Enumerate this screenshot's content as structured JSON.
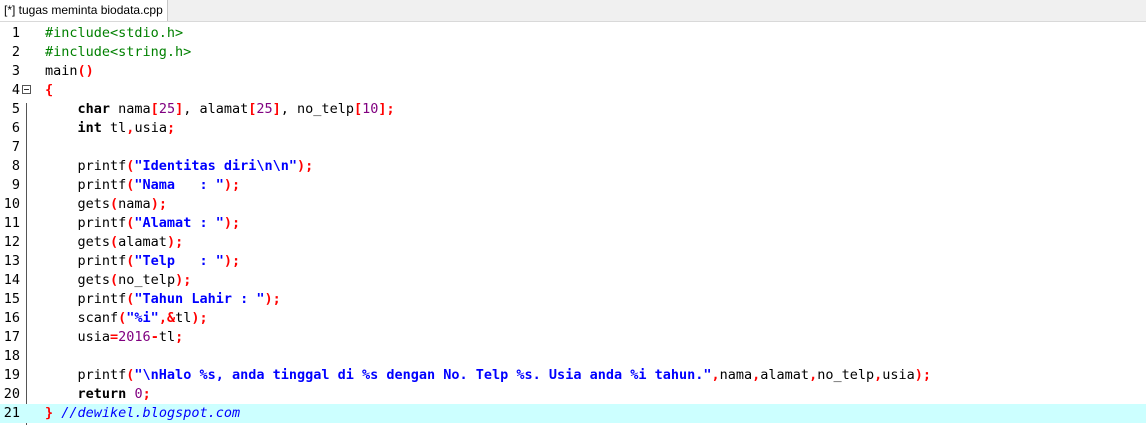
{
  "tab": {
    "label": "[*] tugas meminta biodata.cpp"
  },
  "editor": {
    "active_line": 21,
    "colors": {
      "preprocessor": "#008000",
      "symbol": "#ff0000",
      "number": "#800080",
      "string": "#0000ff",
      "comment": "#0000ff",
      "active_line_bg": "#ccffff"
    },
    "lines": [
      {
        "n": "1",
        "tokens": [
          [
            "pp",
            "#include<stdio.h>"
          ]
        ]
      },
      {
        "n": "2",
        "tokens": [
          [
            "pp",
            "#include<string.h>"
          ]
        ]
      },
      {
        "n": "3",
        "tokens": [
          [
            "id",
            "main"
          ],
          [
            "sym",
            "()"
          ]
        ]
      },
      {
        "n": "4",
        "tokens": [
          [
            "sym",
            "{"
          ]
        ]
      },
      {
        "n": "5",
        "tokens": [
          [
            "id",
            "    "
          ],
          [
            "kw",
            "char"
          ],
          [
            "id",
            " nama"
          ],
          [
            "sym",
            "["
          ],
          [
            "num",
            "25"
          ],
          [
            "sym",
            "]"
          ],
          [
            "id",
            ", alamat"
          ],
          [
            "sym",
            "["
          ],
          [
            "num",
            "25"
          ],
          [
            "sym",
            "]"
          ],
          [
            "id",
            ", no_telp"
          ],
          [
            "sym",
            "["
          ],
          [
            "num",
            "10"
          ],
          [
            "sym",
            "];"
          ]
        ]
      },
      {
        "n": "6",
        "tokens": [
          [
            "id",
            "    "
          ],
          [
            "kw",
            "int"
          ],
          [
            "id",
            " tl"
          ],
          [
            "sym",
            ","
          ],
          [
            "id",
            "usia"
          ],
          [
            "sym",
            ";"
          ]
        ]
      },
      {
        "n": "7",
        "tokens": []
      },
      {
        "n": "8",
        "tokens": [
          [
            "id",
            "    printf"
          ],
          [
            "sym",
            "("
          ],
          [
            "str",
            "\"Identitas diri\\n\\n\""
          ],
          [
            "sym",
            ");"
          ]
        ]
      },
      {
        "n": "9",
        "tokens": [
          [
            "id",
            "    printf"
          ],
          [
            "sym",
            "("
          ],
          [
            "str",
            "\"Nama   : \""
          ],
          [
            "sym",
            ");"
          ]
        ]
      },
      {
        "n": "10",
        "tokens": [
          [
            "id",
            "    gets"
          ],
          [
            "sym",
            "("
          ],
          [
            "id",
            "nama"
          ],
          [
            "sym",
            ");"
          ]
        ]
      },
      {
        "n": "11",
        "tokens": [
          [
            "id",
            "    printf"
          ],
          [
            "sym",
            "("
          ],
          [
            "str",
            "\"Alamat : \""
          ],
          [
            "sym",
            ");"
          ]
        ]
      },
      {
        "n": "12",
        "tokens": [
          [
            "id",
            "    gets"
          ],
          [
            "sym",
            "("
          ],
          [
            "id",
            "alamat"
          ],
          [
            "sym",
            ");"
          ]
        ]
      },
      {
        "n": "13",
        "tokens": [
          [
            "id",
            "    printf"
          ],
          [
            "sym",
            "("
          ],
          [
            "str",
            "\"Telp   : \""
          ],
          [
            "sym",
            ");"
          ]
        ]
      },
      {
        "n": "14",
        "tokens": [
          [
            "id",
            "    gets"
          ],
          [
            "sym",
            "("
          ],
          [
            "id",
            "no_telp"
          ],
          [
            "sym",
            ");"
          ]
        ]
      },
      {
        "n": "15",
        "tokens": [
          [
            "id",
            "    printf"
          ],
          [
            "sym",
            "("
          ],
          [
            "str",
            "\"Tahun Lahir : \""
          ],
          [
            "sym",
            ");"
          ]
        ]
      },
      {
        "n": "16",
        "tokens": [
          [
            "id",
            "    scanf"
          ],
          [
            "sym",
            "("
          ],
          [
            "str",
            "\"%i\""
          ],
          [
            "sym",
            ",&"
          ],
          [
            "id",
            "tl"
          ],
          [
            "sym",
            ");"
          ]
        ]
      },
      {
        "n": "17",
        "tokens": [
          [
            "id",
            "    usia"
          ],
          [
            "sym",
            "="
          ],
          [
            "num",
            "2016"
          ],
          [
            "sym",
            "-"
          ],
          [
            "id",
            "tl"
          ],
          [
            "sym",
            ";"
          ]
        ]
      },
      {
        "n": "18",
        "tokens": []
      },
      {
        "n": "19",
        "tokens": [
          [
            "id",
            "    printf"
          ],
          [
            "sym",
            "("
          ],
          [
            "str",
            "\"\\nHalo %s, anda tinggal di %s dengan No. Telp %s. Usia anda %i tahun.\""
          ],
          [
            "sym",
            ","
          ],
          [
            "id",
            "nama"
          ],
          [
            "sym",
            ","
          ],
          [
            "id",
            "alamat"
          ],
          [
            "sym",
            ","
          ],
          [
            "id",
            "no_telp"
          ],
          [
            "sym",
            ","
          ],
          [
            "id",
            "usia"
          ],
          [
            "sym",
            ");"
          ]
        ]
      },
      {
        "n": "20",
        "tokens": [
          [
            "id",
            "    "
          ],
          [
            "kw",
            "return"
          ],
          [
            "id",
            " "
          ],
          [
            "num",
            "0"
          ],
          [
            "sym",
            ";"
          ]
        ]
      },
      {
        "n": "21",
        "tokens": [
          [
            "sym",
            "}"
          ],
          [
            "id",
            " "
          ],
          [
            "cmt",
            "//dewikel.blogspot.com"
          ]
        ]
      }
    ]
  }
}
